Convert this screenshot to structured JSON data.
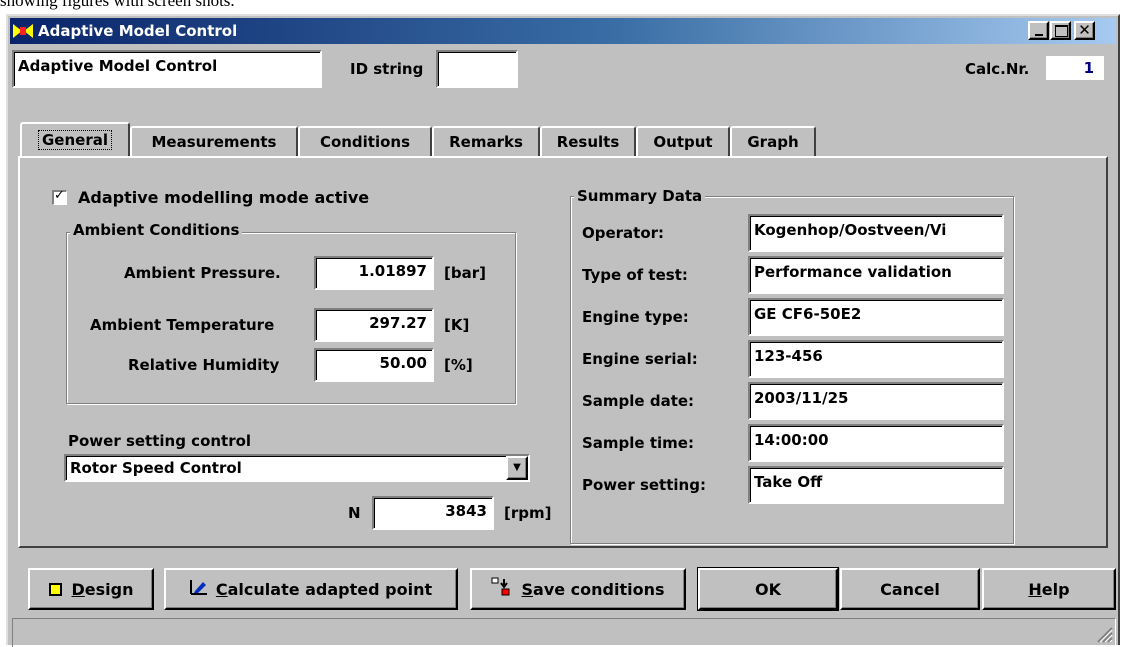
{
  "caption_fragment": "showing figures with screen shots.",
  "window": {
    "title": "Adaptive Model Control"
  },
  "header": {
    "name_value": "Adaptive Model Control",
    "id_label": "ID string",
    "id_value": "",
    "calc_label": "Calc.Nr.",
    "calc_value": "1"
  },
  "tabs": [
    "General",
    "Measurements",
    "Conditions",
    "Remarks",
    "Results",
    "Output",
    "Graph"
  ],
  "general": {
    "adaptive_checkbox_label": "Adaptive modelling mode active",
    "adaptive_checked": true,
    "ambient": {
      "title": "Ambient Conditions",
      "pressure_label": "Ambient Pressure.",
      "pressure_value": "1.01897",
      "pressure_unit": "[bar]",
      "temperature_label": "Ambient Temperature",
      "temperature_value": "297.27",
      "temperature_unit": "[K]",
      "humidity_label": "Relative Humidity",
      "humidity_value": "50.00",
      "humidity_unit": "[%]"
    },
    "power": {
      "label": "Power setting control",
      "selected": "Rotor Speed Control",
      "n_label": "N",
      "n_value": "3843",
      "n_unit": "[rpm]"
    },
    "summary": {
      "title": "Summary Data",
      "rows": [
        {
          "label": "Operator:",
          "value": "Kogenhop/Oostveen/Vi"
        },
        {
          "label": "Type of test:",
          "value": "Performance validation"
        },
        {
          "label": "Engine type:",
          "value": "GE CF6-50E2"
        },
        {
          "label": "Engine serial:",
          "value": "123-456"
        },
        {
          "label": "Sample date:",
          "value": "2003/11/25"
        },
        {
          "label": "Sample time:",
          "value": "14:00:00"
        },
        {
          "label": "Power setting:",
          "value": "Take Off"
        }
      ]
    }
  },
  "buttons": {
    "design_mnemonic": "D",
    "design_rest": "esign",
    "calc_mnemonic": "C",
    "calc_rest": "alculate adapted point",
    "save_mnemonic": "S",
    "save_rest": "ave conditions",
    "ok": "OK",
    "cancel": "Cancel",
    "help_mnemonic": "H",
    "help_rest": "elp"
  },
  "colors": {
    "titlebar_start": "#0a246a",
    "titlebar_end": "#a6caf0",
    "face": "#c0c0c0"
  }
}
